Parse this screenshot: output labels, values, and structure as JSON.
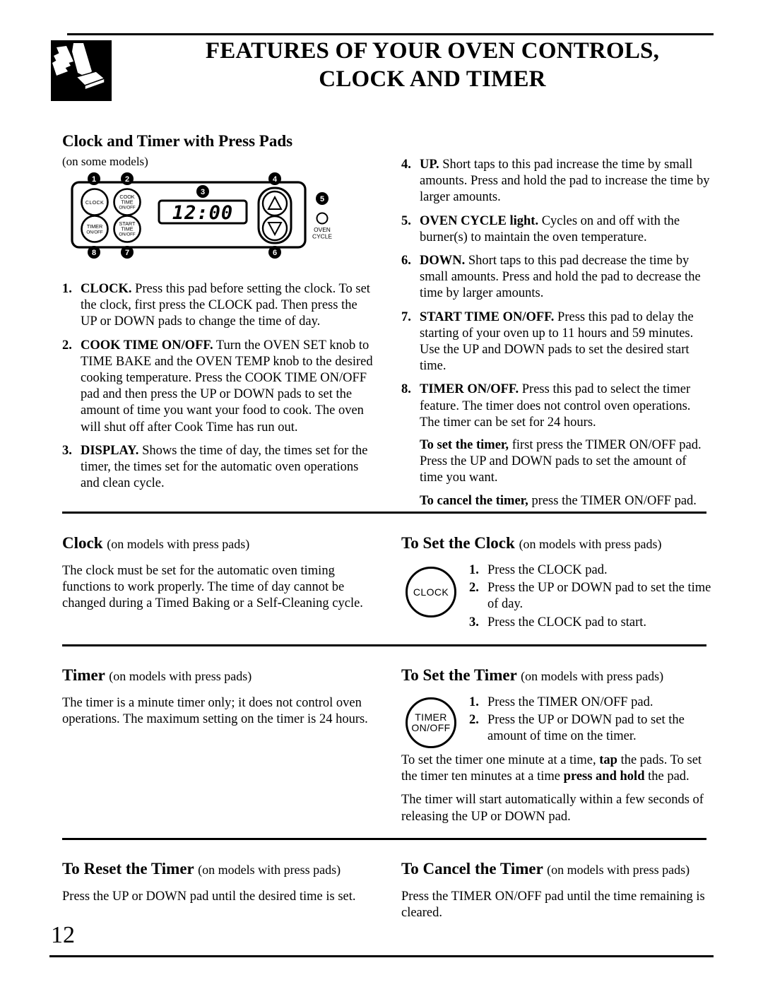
{
  "header": {
    "icon": "hand-pressing-pad-icon",
    "title_line1": "FEATURES OF YOUR OVEN CONTROLS,",
    "title_line2": "CLOCK AND TIMER"
  },
  "intro": {
    "heading": "Clock and Timer with Press Pads",
    "note": "(on some models)"
  },
  "control_panel": {
    "display_value": "12:00",
    "pads": [
      {
        "id": "clock",
        "label_lines": [
          "CLOCK"
        ]
      },
      {
        "id": "cook-time-on-off",
        "label_lines": [
          "COOK",
          "TIME",
          "ON/OFF"
        ]
      },
      {
        "id": "timer-on-off",
        "label_lines": [
          "TIMER",
          "ON/OFF"
        ]
      },
      {
        "id": "start-time-on-off",
        "label_lines": [
          "START",
          "TIME",
          "ON/OFF"
        ]
      }
    ],
    "callouts": [
      "1",
      "2",
      "3",
      "4",
      "5",
      "6",
      "7",
      "8"
    ],
    "oven_cycle_label_line1": "OVEN",
    "oven_cycle_label_line2": "CYCLE",
    "up_arrow": "up-triangle-icon",
    "down_arrow": "down-triangle-icon"
  },
  "features_left": [
    {
      "num": "1.",
      "bold": "CLOCK.",
      "text": " Press this pad before setting the clock. To set the clock, first press the CLOCK pad. Then press the UP or DOWN pads to change the time of day."
    },
    {
      "num": "2.",
      "bold": "COOK TIME ON/OFF.",
      "text": " Turn the OVEN SET knob to TIME BAKE and the OVEN TEMP knob to the desired cooking temperature. Press the COOK TIME ON/OFF pad and then press the UP or DOWN pads to set the amount of time you want your food to cook. The oven will shut off after Cook Time has run out."
    },
    {
      "num": "3.",
      "bold": "DISPLAY.",
      "text": " Shows the time of day, the times set for the timer, the times set for the automatic oven operations and clean cycle."
    }
  ],
  "features_right": [
    {
      "num": "4.",
      "bold": "UP.",
      "text": " Short taps to this pad increase the time by small amounts. Press and hold the pad to increase the time by larger amounts."
    },
    {
      "num": "5.",
      "bold": "OVEN CYCLE light.",
      "text": " Cycles on and off with the burner(s) to maintain the oven temperature."
    },
    {
      "num": "6.",
      "bold": "DOWN.",
      "text": " Short taps to this pad decrease the time by small amounts. Press and hold the pad to decrease the time by larger amounts."
    },
    {
      "num": "7.",
      "bold": "START TIME ON/OFF.",
      "text": " Press this pad to delay the starting of your oven up to 11 hours and 59 minutes. Use the UP and DOWN pads to set the desired start time."
    },
    {
      "num": "8.",
      "bold": "TIMER ON/OFF.",
      "text": " Press this pad to select the timer feature. The timer does not control oven operations. The timer can be set for 24 hours."
    }
  ],
  "timer_extra": [
    {
      "bold": "To set the timer,",
      "text": " first press the TIMER ON/OFF pad. Press the UP and DOWN pads to set the amount of time you want."
    },
    {
      "bold": "To cancel the timer,",
      "text": " press the TIMER ON/OFF pad."
    }
  ],
  "clock_section": {
    "heading": "Clock",
    "heading_note": "(on models with press pads)",
    "body": "The clock must be set for the automatic oven timing functions to work properly. The time of day cannot be changed during a Timed Baking or a Self-Cleaning cycle."
  },
  "set_clock_section": {
    "heading": "To Set the Clock",
    "heading_note": "(on models with press pads)",
    "pad_label_lines": [
      "CLOCK"
    ],
    "steps": [
      {
        "num": "1.",
        "text": "Press the CLOCK pad."
      },
      {
        "num": "2.",
        "text": "Press the UP or DOWN pad to set the time of day."
      },
      {
        "num": "3.",
        "text": "Press the CLOCK pad to start."
      }
    ]
  },
  "timer_section": {
    "heading": "Timer",
    "heading_note": "(on models with press pads)",
    "body": "The timer is a minute timer only; it does not control oven operations. The maximum setting on the timer is 24 hours."
  },
  "set_timer_section": {
    "heading": "To Set the Timer",
    "heading_note": "(on models with press pads)",
    "pad_label_line1": "TIMER",
    "pad_label_line2": "ON/OFF",
    "steps": [
      {
        "num": "1.",
        "text": "Press the TIMER ON/OFF pad."
      },
      {
        "num": "2.",
        "text": "Press the UP or DOWN pad to set the amount of time on the timer."
      }
    ],
    "para1_a": "To set the timer one minute at a time, ",
    "para1_b": "tap",
    "para1_c": " the pads. To set the timer ten minutes at a time ",
    "para1_d": "press and hold",
    "para1_e": " the pad.",
    "para2": "The timer will start automatically within a few seconds of releasing the UP or DOWN pad."
  },
  "reset_timer_section": {
    "heading": "To Reset the Timer",
    "heading_note": "(on models with press pads)",
    "body": "Press the UP or DOWN pad until the desired time is set."
  },
  "cancel_timer_section": {
    "heading": "To Cancel the Timer",
    "heading_note": "(on models with press pads)",
    "body": "Press the TIMER ON/OFF pad until the time remaining is cleared."
  },
  "footer": {
    "page_number": "12"
  }
}
